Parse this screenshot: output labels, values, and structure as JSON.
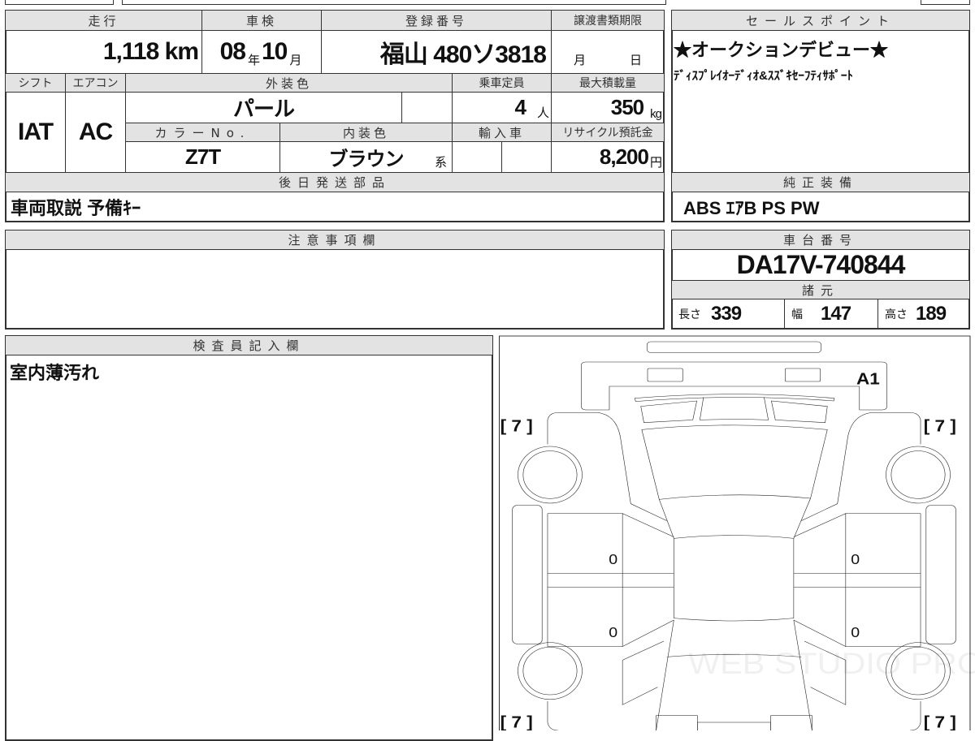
{
  "mileage": {
    "label": "走行",
    "value": "1,118",
    "unit": "km"
  },
  "inspection": {
    "label": "車検",
    "year": "08",
    "year_unit": "年",
    "month": "10",
    "month_unit": "月"
  },
  "registration": {
    "label": "登録番号",
    "value": "福山 480ソ3818"
  },
  "transfer_deadline": {
    "label": "譲渡書類期限",
    "month_unit": "月",
    "day_unit": "日"
  },
  "shift": {
    "label": "シフト",
    "value": "IAT"
  },
  "aircon": {
    "label": "エアコン",
    "value": "AC"
  },
  "exterior_color": {
    "label": "外装色",
    "value": "パール"
  },
  "capacity": {
    "label": "乗車定員",
    "value": "4",
    "unit": "人"
  },
  "max_load": {
    "label": "最大積載量",
    "value": "350",
    "unit": "kg"
  },
  "color_no": {
    "label": "カラーNo.",
    "value": "Z7T"
  },
  "interior_color": {
    "label": "内装色",
    "value": "ブラウン",
    "suffix": "系"
  },
  "import": {
    "label": "輸入車"
  },
  "recycle": {
    "label": "リサイクル預託金",
    "value": "8,200",
    "unit": "円"
  },
  "later_parts": {
    "label": "後日発送部品",
    "value": "車両取説 予備ｷｰ"
  },
  "sales_points": {
    "label": "セールスポイント",
    "line1": "★オークションデビュー★",
    "line2": "ﾃﾞｨｽﾌﾟﾚｲｵｰﾃﾞｨｵ&ｽｽﾞｷｾｰﾌﾃｨｻﾎﾟｰﾄ"
  },
  "equipment": {
    "label": "純正装備",
    "value": "ABS ｴｱB PS PW"
  },
  "notes": {
    "label": "注意事項欄",
    "value": ""
  },
  "chassis": {
    "label": "車台番号",
    "value": "DA17V-740844"
  },
  "specs": {
    "label": "諸元",
    "length_label": "長さ",
    "length": "339",
    "width_label": "幅",
    "width": "147",
    "height_label": "高さ",
    "height": "189"
  },
  "inspector": {
    "label": "検査員記入欄",
    "value": "室内薄汚れ"
  },
  "diagram": {
    "tire_fl": "[ 7 ]",
    "tire_fr": "[ 7 ]",
    "tire_rl": "[ 7 ]",
    "tire_rr": "[ 7 ]",
    "front_mark": "A1",
    "door_fl": "0",
    "door_rl": "0",
    "door_fr": "0",
    "door_rr": "0",
    "watermark": "WEB STUDIO PRO"
  }
}
